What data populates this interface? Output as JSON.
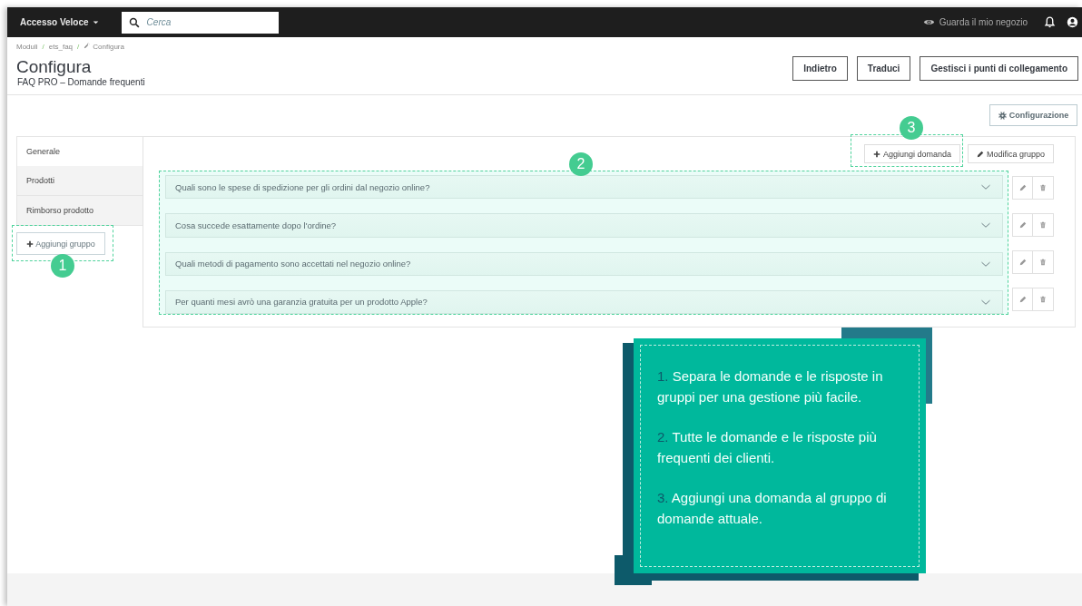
{
  "topbar": {
    "quick_access": "Accesso Veloce",
    "search": {
      "placeholder": "Cerca"
    },
    "view_shop": "Guarda il mio negozio"
  },
  "breadcrumb": {
    "separator": "/",
    "items": [
      "Moduli",
      "ets_faq",
      "Configura"
    ]
  },
  "header": {
    "title": "Configura",
    "subtitle": "FAQ PRO – Domande frequenti",
    "buttons": [
      "Indietro",
      "Traduci",
      "Gestisci i punti di collegamento"
    ]
  },
  "config_button": "Configurazione",
  "groups": [
    {
      "label": "Generale",
      "selected": true
    },
    {
      "label": "Prodotti",
      "selected": false
    },
    {
      "label": "Rimborso prodotto",
      "selected": false
    }
  ],
  "add_group_button": "Aggiungi gruppo",
  "add_question_button": "Aggiungi domanda",
  "edit_group_button": "Modifica gruppo",
  "questions": [
    {
      "text": "Quali sono le spese di spedizione per gli ordini dal negozio online?"
    },
    {
      "text": "Cosa succede esattamente dopo l'ordine?"
    },
    {
      "text": "Quali metodi di pagamento sono accettati nel negozio online?"
    },
    {
      "text": "Per quanti mesi avrò una garanzia gratuita per un prodotto Apple?"
    }
  ],
  "annotations": {
    "badges": [
      "1",
      "2",
      "3"
    ],
    "notes": [
      {
        "number": "1.",
        "text": "Separa le domande e le risposte in gruppi per una gestione più facile."
      },
      {
        "number": "2.",
        "text": "Tutte le domande e le risposte più frequenti dei clienti."
      },
      {
        "number": "3.",
        "text": "Aggiungi una domanda al gruppo di domande attuale."
      }
    ]
  }
}
